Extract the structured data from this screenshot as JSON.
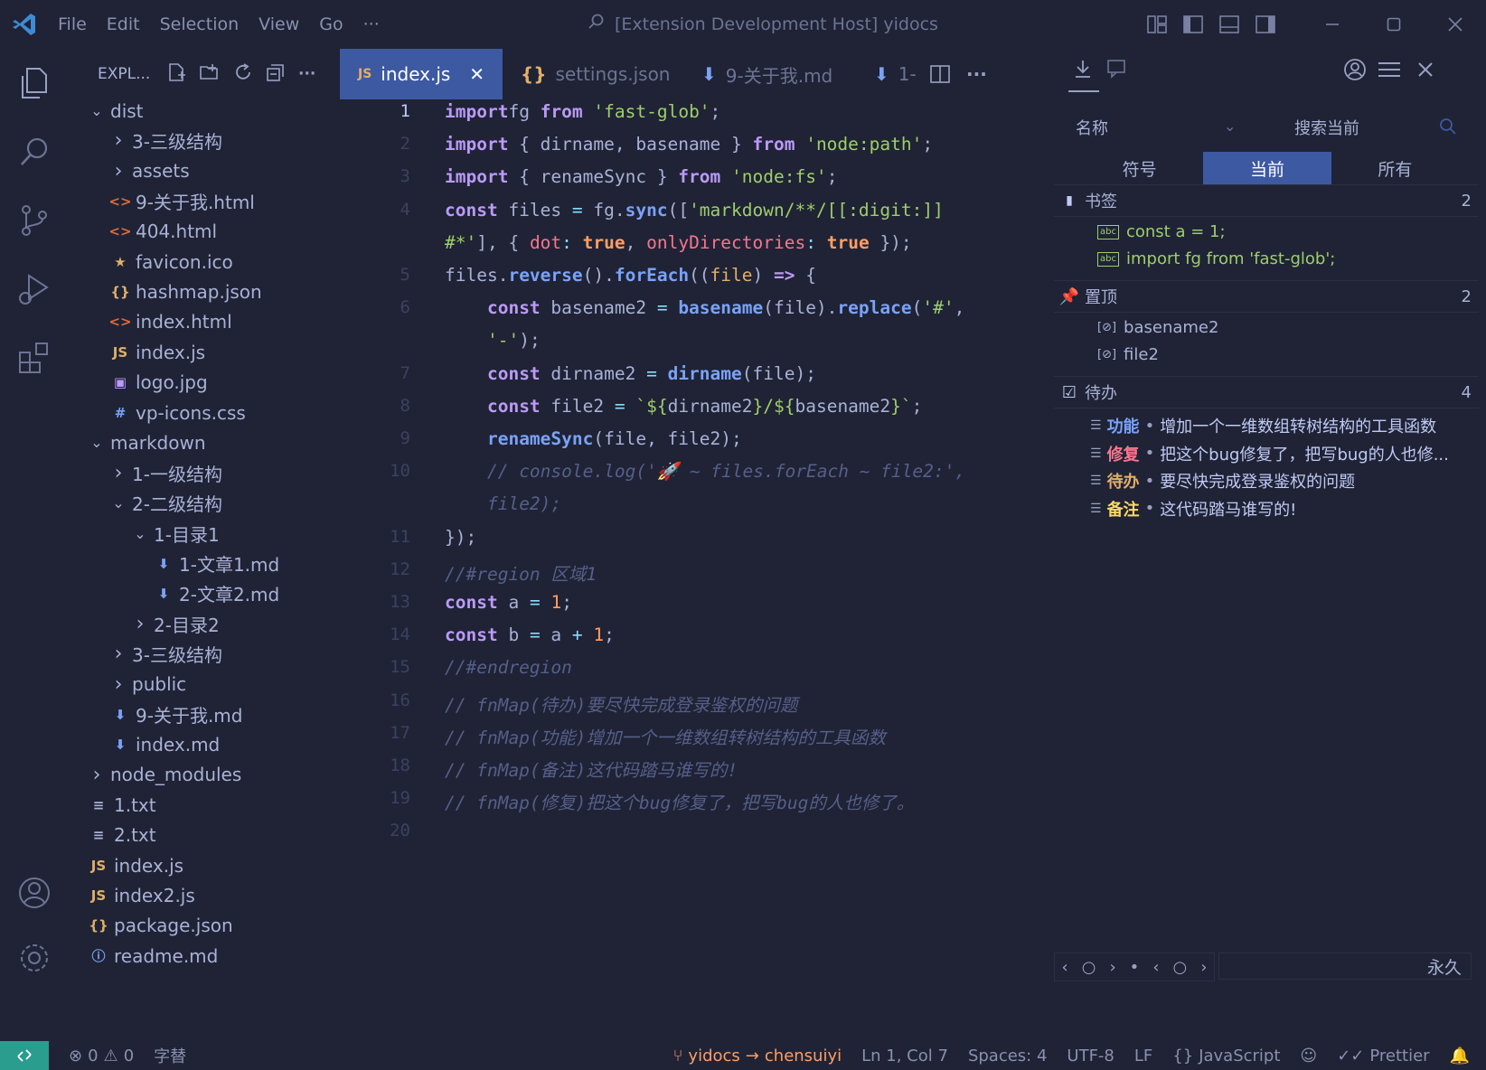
{
  "window": {
    "title": "[Extension Development Host] yidocs",
    "menu": [
      "File",
      "Edit",
      "Selection",
      "View",
      "Go",
      "···"
    ]
  },
  "sidebar": {
    "header": "EXPL...",
    "tree": [
      {
        "label": "dist",
        "kind": "folder-open",
        "depth": 0
      },
      {
        "label": "3-三级结构",
        "kind": "folder",
        "depth": 1
      },
      {
        "label": "assets",
        "kind": "folder",
        "depth": 1
      },
      {
        "label": "9-关于我.html",
        "kind": "html",
        "depth": 1
      },
      {
        "label": "404.html",
        "kind": "html",
        "depth": 1
      },
      {
        "label": "favicon.ico",
        "kind": "star",
        "depth": 1
      },
      {
        "label": "hashmap.json",
        "kind": "json",
        "depth": 1
      },
      {
        "label": "index.html",
        "kind": "html",
        "depth": 1
      },
      {
        "label": "index.js",
        "kind": "js",
        "depth": 1
      },
      {
        "label": "logo.jpg",
        "kind": "image",
        "depth": 1
      },
      {
        "label": "vp-icons.css",
        "kind": "css",
        "depth": 1
      },
      {
        "label": "markdown",
        "kind": "folder-open",
        "depth": 0
      },
      {
        "label": "1-一级结构",
        "kind": "folder",
        "depth": 1
      },
      {
        "label": "2-二级结构",
        "kind": "folder-open",
        "depth": 1
      },
      {
        "label": "1-目录1",
        "kind": "folder-open",
        "depth": 2
      },
      {
        "label": "1-文章1.md",
        "kind": "md",
        "depth": 3
      },
      {
        "label": "2-文章2.md",
        "kind": "md",
        "depth": 3
      },
      {
        "label": "2-目录2",
        "kind": "folder",
        "depth": 2
      },
      {
        "label": "3-三级结构",
        "kind": "folder",
        "depth": 1
      },
      {
        "label": "public",
        "kind": "folder",
        "depth": 1
      },
      {
        "label": "9-关于我.md",
        "kind": "md",
        "depth": 1
      },
      {
        "label": "index.md",
        "kind": "md",
        "depth": 1
      },
      {
        "label": "node_modules",
        "kind": "folder",
        "depth": 0
      },
      {
        "label": "1.txt",
        "kind": "txt",
        "depth": 0
      },
      {
        "label": "2.txt",
        "kind": "txt",
        "depth": 0
      },
      {
        "label": "index.js",
        "kind": "js",
        "depth": 0
      },
      {
        "label": "index2.js",
        "kind": "js",
        "depth": 0
      },
      {
        "label": "package.json",
        "kind": "json",
        "depth": 0
      },
      {
        "label": "readme.md",
        "kind": "info",
        "depth": 0
      }
    ]
  },
  "tabs": [
    {
      "label": "index.js",
      "prefix": "JS",
      "close": "✕",
      "active": true
    },
    {
      "label": "settings.json",
      "prefix": "{}",
      "active": false
    },
    {
      "label": "9-关于我.md",
      "prefix": "⬇",
      "active": false
    },
    {
      "label": "1-",
      "prefix": "⬇",
      "active": false
    }
  ],
  "editor": {
    "line_numbers": [
      "1",
      "2",
      "3",
      "4",
      "",
      "5",
      "6",
      "",
      "7",
      "8",
      "9",
      "10",
      "",
      "11",
      "12",
      "13",
      "14",
      "15",
      "16",
      "17",
      "18",
      "19",
      "20"
    ],
    "lines": [
      [
        [
          "kw",
          "import"
        ],
        [
          "",
          "fg "
        ],
        [
          "kw",
          "from"
        ],
        [
          "",
          " "
        ],
        [
          "str",
          "'fast-glob'"
        ],
        [
          "",
          ";"
        ]
      ],
      [
        [
          "kw",
          "import"
        ],
        [
          "",
          " { dirname, basename } "
        ],
        [
          "kw",
          "from"
        ],
        [
          "",
          " "
        ],
        [
          "str",
          "'node:path'"
        ],
        [
          "",
          ";"
        ]
      ],
      [
        [
          "kw",
          "import"
        ],
        [
          "",
          " { renameSync } "
        ],
        [
          "kw",
          "from"
        ],
        [
          "",
          " "
        ],
        [
          "str",
          "'node:fs'"
        ],
        [
          "",
          ";"
        ]
      ],
      [
        [
          "kw",
          "const"
        ],
        [
          "",
          " files "
        ],
        [
          "op",
          "="
        ],
        [
          "",
          " fg."
        ],
        [
          "fn",
          "sync"
        ],
        [
          "",
          "(["
        ],
        [
          "str",
          "'markdown/**/[[:digit:]]"
        ]
      ],
      [
        [
          "str",
          "#*'"
        ],
        [
          "",
          "], { "
        ],
        [
          "prop",
          "dot"
        ],
        [
          "op",
          ":"
        ],
        [
          "",
          " "
        ],
        [
          "bool",
          "true"
        ],
        [
          "",
          ", "
        ],
        [
          "prop",
          "onlyDirectories"
        ],
        [
          "op",
          ":"
        ],
        [
          "",
          " "
        ],
        [
          "bool",
          "true"
        ],
        [
          "",
          " });"
        ]
      ],
      [
        [
          "",
          "files."
        ],
        [
          "fn",
          "reverse"
        ],
        [
          "",
          "()."
        ],
        [
          "fn",
          "forEach"
        ],
        [
          "",
          "(("
        ],
        [
          "var",
          "file"
        ],
        [
          "",
          ") "
        ],
        [
          "kw",
          "=>"
        ],
        [
          "",
          " {"
        ]
      ],
      [
        [
          "",
          "    "
        ],
        [
          "kw",
          "const"
        ],
        [
          "",
          " basename2 "
        ],
        [
          "op",
          "="
        ],
        [
          "",
          " "
        ],
        [
          "fn",
          "basename"
        ],
        [
          "",
          "(file)."
        ],
        [
          "fn",
          "replace"
        ],
        [
          "",
          "("
        ],
        [
          "str",
          "'#'"
        ],
        [
          "",
          ","
        ]
      ],
      [
        [
          "",
          "    "
        ],
        [
          "str",
          "'-'"
        ],
        [
          "",
          ");"
        ]
      ],
      [
        [
          "",
          "    "
        ],
        [
          "kw",
          "const"
        ],
        [
          "",
          " dirname2 "
        ],
        [
          "op",
          "="
        ],
        [
          "",
          " "
        ],
        [
          "fn",
          "dirname"
        ],
        [
          "",
          "(file);"
        ]
      ],
      [
        [
          "",
          "    "
        ],
        [
          "kw",
          "const"
        ],
        [
          "",
          " file2 "
        ],
        [
          "op",
          "="
        ],
        [
          "",
          " "
        ],
        [
          "str",
          "`${"
        ],
        [
          "",
          "dirname2"
        ],
        [
          "str",
          "}/${"
        ],
        [
          "",
          "basename2"
        ],
        [
          "str",
          "}`"
        ],
        [
          "",
          ";"
        ]
      ],
      [
        [
          "",
          "    "
        ],
        [
          "fn",
          "renameSync"
        ],
        [
          "",
          "(file, file2);"
        ]
      ],
      [
        [
          "",
          "    "
        ],
        [
          "cm",
          "// console.log('🚀 ~ files.forEach ~ file2:',"
        ]
      ],
      [
        [
          "",
          "    "
        ],
        [
          "cm",
          "file2);"
        ]
      ],
      [
        [
          "",
          "});"
        ]
      ],
      [
        [
          "cm",
          "//#region 区域1"
        ]
      ],
      [
        [
          "kw",
          "const"
        ],
        [
          "",
          " a "
        ],
        [
          "op",
          "="
        ],
        [
          "",
          " "
        ],
        [
          "num",
          "1"
        ],
        [
          "",
          ";"
        ]
      ],
      [
        [
          "kw",
          "const"
        ],
        [
          "",
          " b "
        ],
        [
          "op",
          "="
        ],
        [
          "",
          " a "
        ],
        [
          "op",
          "+"
        ],
        [
          "",
          " "
        ],
        [
          "num",
          "1"
        ],
        [
          "",
          ";"
        ]
      ],
      [
        [
          "cm",
          "//#endregion"
        ]
      ],
      [
        [
          "cm",
          "// fnMap(待办)要尽快完成登录鉴权的问题"
        ]
      ],
      [
        [
          "cm",
          "// fnMap(功能)增加一个一维数组转树结构的工具函数"
        ]
      ],
      [
        [
          "cm",
          "// fnMap(备注)这代码踏马谁写的!"
        ]
      ],
      [
        [
          "cm",
          "// fnMap(修复)把这个bug修复了，把写bug的人也修了。"
        ]
      ],
      [
        [
          "",
          ""
        ]
      ]
    ]
  },
  "panel": {
    "name_label": "名称",
    "search_label": "搜索当前",
    "scope_tabs": [
      "符号",
      "当前",
      "所有"
    ],
    "active_scope": 1,
    "sections": {
      "bookmarks": {
        "title": "书签",
        "count": "2",
        "items": [
          "const a = 1;",
          "import fg from 'fast-glob';"
        ]
      },
      "pinned": {
        "title": "置顶",
        "count": "2",
        "items": [
          "basename2",
          "file2"
        ]
      },
      "todo": {
        "title": "待办",
        "count": "4",
        "items": [
          {
            "tag": "功能",
            "text": "增加一个一维数组转树结构的工具函数",
            "color": "#7aa2f7"
          },
          {
            "tag": "修复",
            "text": "把这个bug修复了，把写bug的人也修...",
            "color": "#f7768e"
          },
          {
            "tag": "待办",
            "text": "要尽快完成登录鉴权的问题",
            "color": "#e0af68"
          },
          {
            "tag": "备注",
            "text": "这代码踏马谁写的!",
            "color": "#ffd866"
          }
        ]
      }
    },
    "footer_right": "永久"
  },
  "statusbar": {
    "errors": "0",
    "warnings": "0",
    "font_label": "字替",
    "branch": "yidocs",
    "branch_target": "chensuiyi",
    "position": "Ln 1, Col 7",
    "spaces": "Spaces: 4",
    "encoding": "UTF-8",
    "eol": "LF",
    "language": "JavaScript",
    "formatter": "Prettier"
  },
  "colors": {
    "background": "#1f2335",
    "accent": "#3d59a1",
    "keyword": "#bb9af7",
    "string": "#9ece6a",
    "function": "#7aa2f7",
    "comment": "#565f89",
    "remote": "#2a9d8f"
  }
}
